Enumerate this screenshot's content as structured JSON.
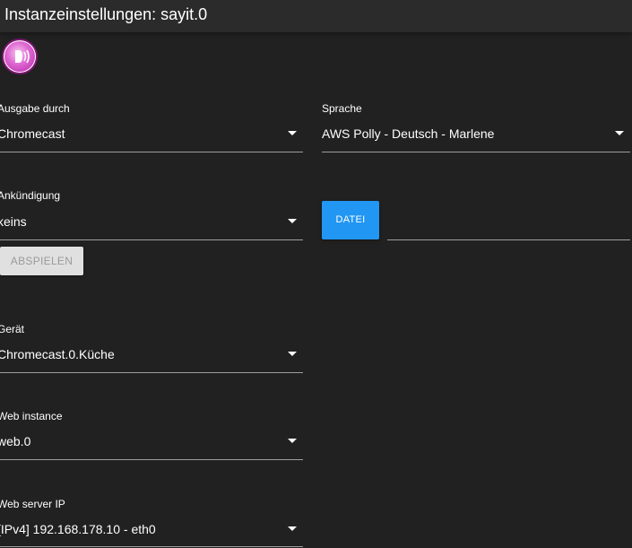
{
  "window": {
    "title": "Instanzeinstellungen: sayit.0"
  },
  "logo": {
    "icon": "sayit-speaker-icon",
    "color": "#d63cc7"
  },
  "fields": {
    "output": {
      "label": "Ausgabe durch",
      "value": "Chromecast"
    },
    "language": {
      "label": "Sprache",
      "value": "AWS Polly - Deutsch - Marlene"
    },
    "announcement": {
      "label": "Ankündigung",
      "value": "keins"
    },
    "device": {
      "label": "Gerät",
      "value": "Chromecast.0.Küche"
    },
    "web_instance": {
      "label": "Web instance",
      "value": "web.0"
    },
    "web_server_ip": {
      "label": "Web server IP",
      "value": "[IPv4] 192.168.178.10 - eth0"
    }
  },
  "buttons": {
    "play_label": "ABSPIELEN",
    "file_label": "DATEI"
  },
  "colors": {
    "background": "#212121",
    "titlebar": "#2b2b2b",
    "accent": "#2196f3",
    "underline": "#9e9e9e",
    "disabled_button": "#e0e0e0"
  }
}
